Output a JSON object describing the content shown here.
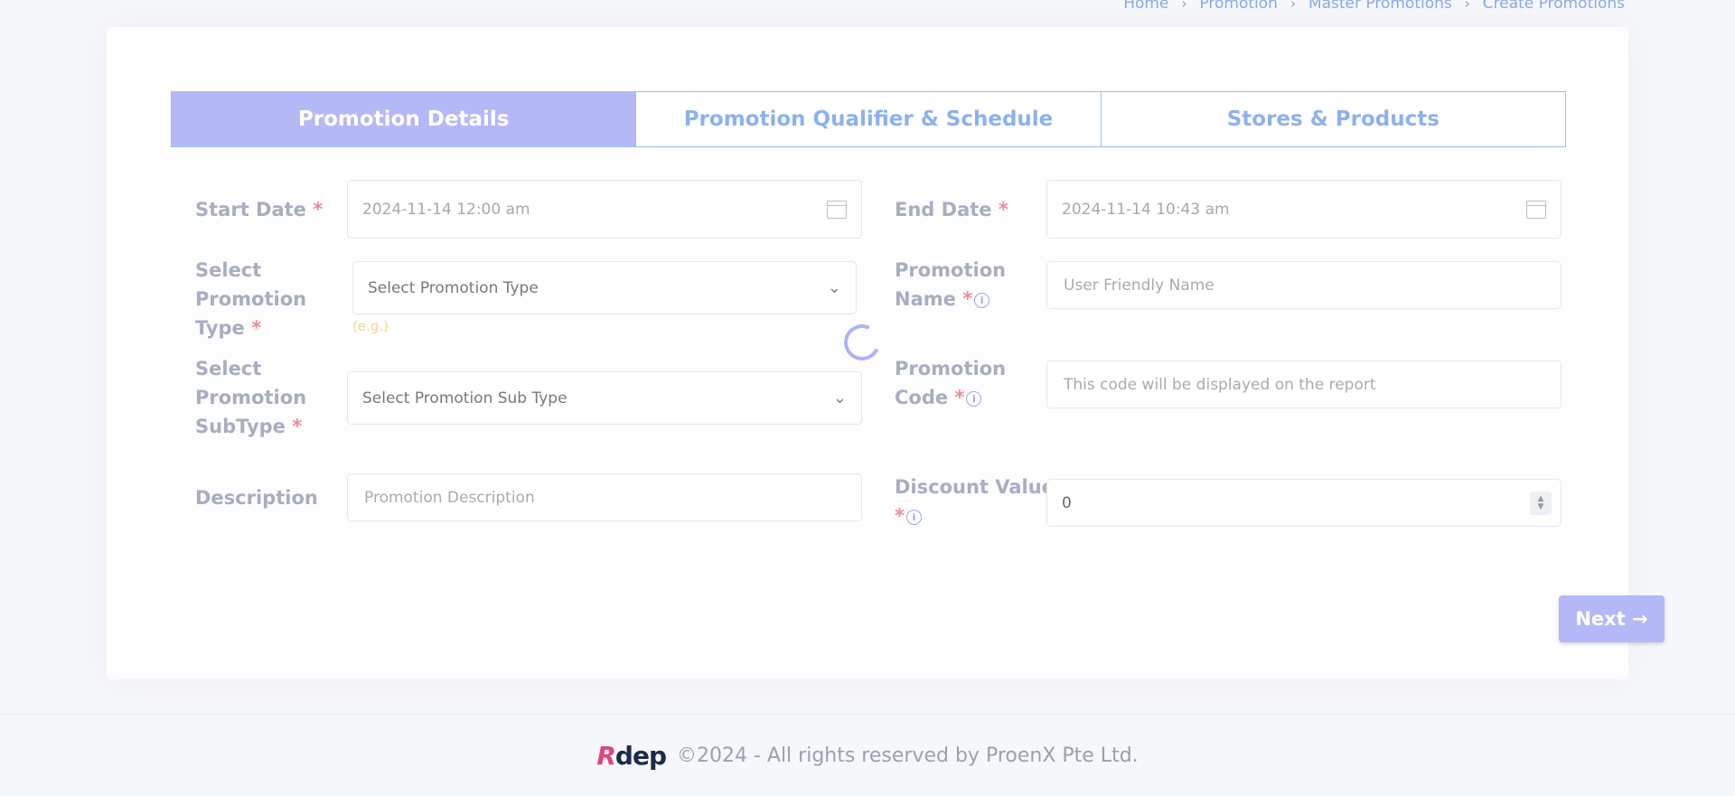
{
  "breadcrumb": {
    "items": [
      "Home",
      "Promotion",
      "Master Promotions",
      "Create Promotions"
    ]
  },
  "tabs": [
    {
      "label": "Promotion Details",
      "active": true
    },
    {
      "label": "Promotion Qualifier & Schedule",
      "active": false
    },
    {
      "label": "Stores & Products",
      "active": false
    }
  ],
  "form": {
    "start_date": {
      "label": "Start Date",
      "value": "2024-11-14 12:00 am"
    },
    "end_date": {
      "label": "End Date",
      "value": "2024-11-14 10:43 am"
    },
    "promotion_type": {
      "label_1": "Select",
      "label_2": "Promotion",
      "label_3": "Type",
      "placeholder": "Select Promotion Type",
      "hint": "(e.g.)"
    },
    "promotion_name": {
      "label_1": "Promotion",
      "label_2": "Name",
      "placeholder": "User Friendly Name"
    },
    "promotion_subtype": {
      "label_1": "Select",
      "label_2": "Promotion",
      "label_3": "SubType",
      "placeholder": "Select Promotion Sub Type"
    },
    "promotion_code": {
      "label_1": "Promotion",
      "label_2": "Code",
      "placeholder": "This code will be displayed on the report"
    },
    "description": {
      "label": "Description",
      "placeholder": "Promotion Description"
    },
    "discount_value": {
      "label_1": "Discount Value",
      "value": "0"
    },
    "required_mark": "*",
    "info_glyph": "i"
  },
  "next_button": {
    "label": "Next →"
  },
  "footer": {
    "logo_r": "R",
    "logo_rest": "dep",
    "copyright": "©2024 - All rights reserved by ProenX Pte Ltd."
  },
  "colors": {
    "accent": "#b5b8f6",
    "tab_text": "#8cb1ef",
    "required": "#f08a9a"
  }
}
